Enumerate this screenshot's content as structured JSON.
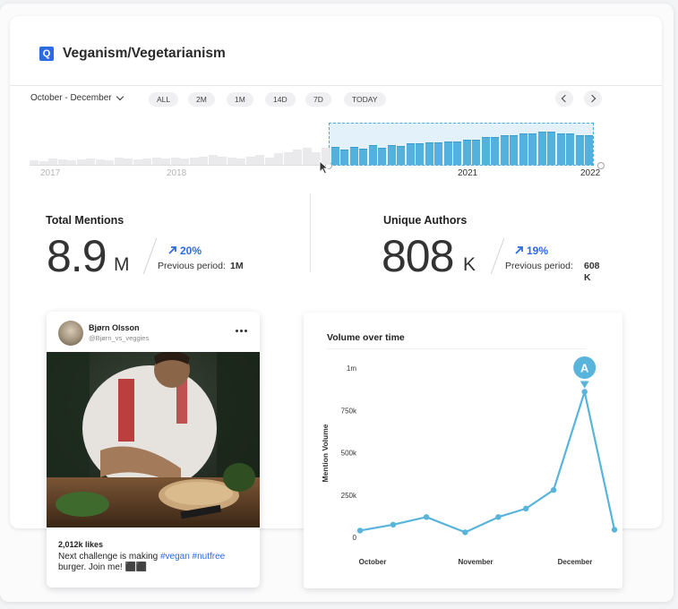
{
  "header": {
    "badge": "Q",
    "title": "Veganism/Vegetarianism"
  },
  "controls": {
    "range_label": "October - December",
    "presets": [
      "ALL",
      "2M",
      "1M",
      "14D",
      "7D",
      "TODAY"
    ]
  },
  "timeline": {
    "year_labels": [
      "2017",
      "2018",
      "2021",
      "2022"
    ],
    "volume_levels": [
      0.25,
      0.2,
      0.3,
      0.26,
      0.24,
      0.28,
      0.32,
      0.27,
      0.22,
      0.36,
      0.3,
      0.26,
      0.33,
      0.35,
      0.31,
      0.38,
      0.3,
      0.35,
      0.42,
      0.48,
      0.4,
      0.36,
      0.3,
      0.4,
      0.48,
      0.38,
      0.58,
      0.62,
      0.78,
      0.85,
      0.62,
      0.85,
      0.9,
      0.78,
      0.9,
      0.82,
      1.0,
      0.88,
      1.0,
      0.95,
      1.08,
      1.08,
      1.12,
      1.12,
      1.18,
      1.18,
      1.28,
      1.28,
      1.42,
      1.42,
      1.5,
      1.5,
      1.58,
      1.58,
      1.66,
      1.66,
      1.58,
      1.58,
      1.48,
      1.48
    ],
    "selected_from_index": 32,
    "colors": {
      "inactive": "#eaeaec",
      "active": "#52b2dd",
      "active_border": "#3c9ccc"
    }
  },
  "metrics": {
    "total_mentions": {
      "label": "Total Mentions",
      "value": "8.9",
      "unit": "M",
      "change": "20%",
      "previous_label": "Previous period:",
      "previous_value": "1M"
    },
    "unique_authors": {
      "label": "Unique Authors",
      "value": "808",
      "unit": "K",
      "change": "19%",
      "previous_label": "Previous period:",
      "previous_value": "608 K"
    }
  },
  "post": {
    "author_name": "Bjørn Olsson",
    "author_handle": "@Bjørn_vs_veggies",
    "likes": "2,012k likes",
    "caption_text": "Next challenge is making",
    "tag1": "#vegan",
    "tag2": "#nutfree",
    "caption_end": "burger. Join me! ⬛⬛"
  },
  "chart_data": {
    "type": "line",
    "title": "Volume over time",
    "ylabel": "Mention Volume",
    "xlabel": "",
    "y_ticks": [
      0,
      250000,
      500000,
      750000,
      1000000
    ],
    "y_tick_labels": [
      "0",
      "250k",
      "500k",
      "750k",
      "1m"
    ],
    "ylim": [
      0,
      1000000
    ],
    "x_tick_labels": [
      "October",
      "November",
      "December"
    ],
    "x_range": [
      0,
      2
    ],
    "grid": false,
    "legend": "none",
    "series": [
      {
        "color": "#59b4dc",
        "x": [
          0,
          0.3,
          0.6,
          0.95,
          1.25,
          1.5,
          1.75,
          2.03,
          2.3
        ],
        "values": [
          40000,
          75000,
          120000,
          30000,
          120000,
          170000,
          280000,
          860000,
          45000
        ]
      }
    ],
    "annotation": {
      "label": "A",
      "point_index": 7
    }
  }
}
